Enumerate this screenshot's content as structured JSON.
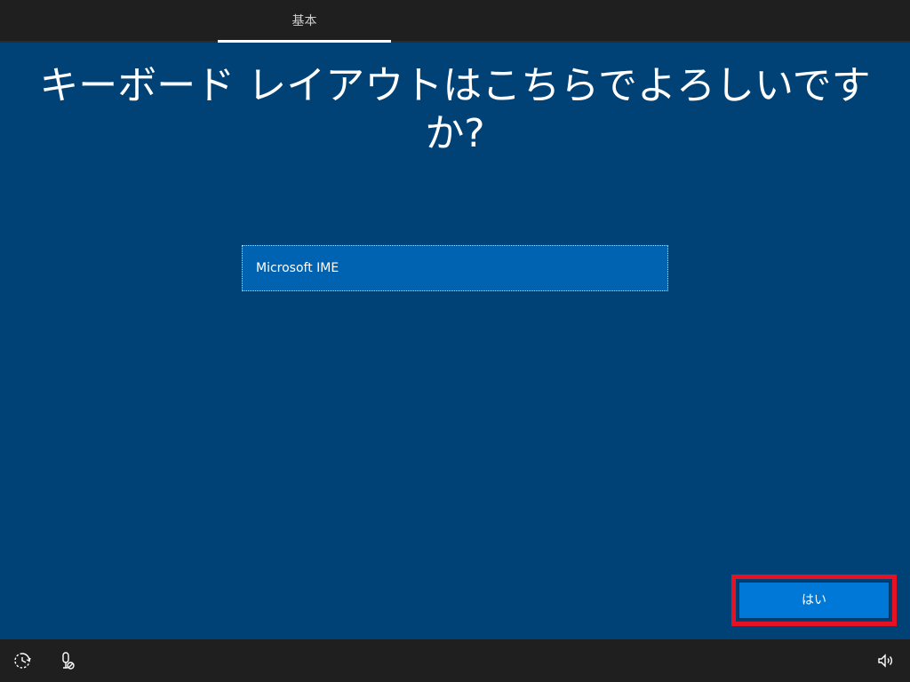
{
  "header": {
    "tabs": [
      {
        "label": "基本"
      }
    ]
  },
  "main": {
    "title": "キーボード レイアウトはこちらでよろしいですか?",
    "layouts": [
      {
        "label": "Microsoft IME"
      }
    ],
    "yes_button_label": "はい"
  },
  "footer": {
    "icons": [
      "ease-of-access-icon",
      "microphone-icon",
      "volume-icon"
    ]
  },
  "colors": {
    "background": "#004275",
    "bar": "#1f1f1f",
    "selected_item": "#0063b1",
    "button": "#0078d7",
    "highlight": "#e81123"
  }
}
